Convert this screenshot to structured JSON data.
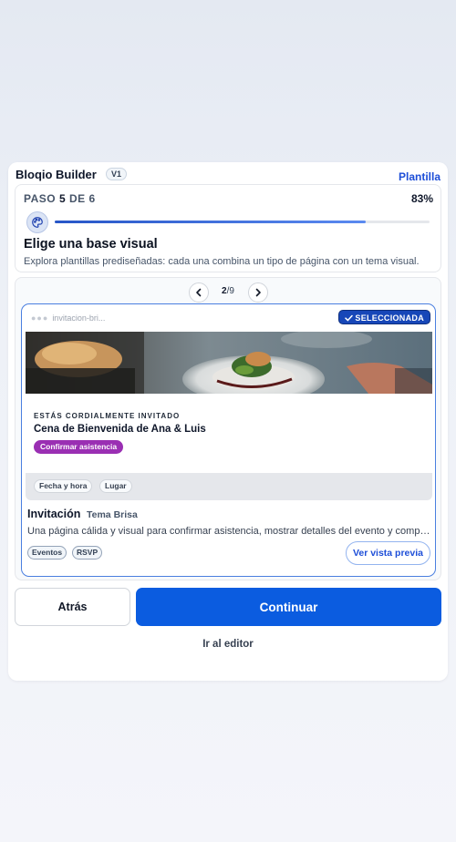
{
  "app": {
    "title": "Bloqio Builder",
    "version": "V1",
    "template_link": "Plantilla"
  },
  "step": {
    "prefix": "PASO",
    "current": "5",
    "of": "DE",
    "total": "6",
    "percent": "83%",
    "progress": 0.83,
    "title": "Elige una base visual",
    "description": "Explora plantillas prediseñadas: cada una combina un tipo de página con un tema visual."
  },
  "pager": {
    "current": "2",
    "separator": "/",
    "total": "9"
  },
  "template": {
    "url_label": "invitacion-bri...",
    "selected_label": "SELECCIONADA",
    "preview": {
      "eyebrow": "ESTÁS CORDIALMENTE INVITADO",
      "event_title": "Cena de Bienvenida de Ana & Luis",
      "rsvp_button": "Confirmar asistencia",
      "chips": [
        "Fecha y hora",
        "Lugar"
      ]
    },
    "name": "Invitación",
    "theme": "Tema Brisa",
    "description": "Una página cálida y visual para confirmar asistencia, mostrar detalles del evento y compartir la ubicación.",
    "tags": [
      "Eventos",
      "RSVP"
    ],
    "preview_button": "Ver vista previa"
  },
  "actions": {
    "back": "Atrás",
    "continue": "Continuar",
    "editor": "Ir al editor"
  },
  "colors": {
    "accent": "#0b5ce0",
    "selected_badge": "#1747b8",
    "rsvp": "#9a2fb3"
  },
  "icons": {
    "step_icon": "palette-icon",
    "prev": "chevron-left-icon",
    "next": "chevron-right-icon",
    "check": "check-icon"
  }
}
